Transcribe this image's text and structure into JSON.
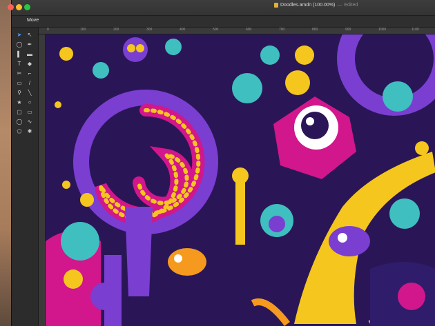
{
  "window": {
    "title": "Doodles.amdn (100.00%)",
    "separator": "—",
    "status": "Edited"
  },
  "toolbar": {
    "active_tool": "Move"
  },
  "ruler": {
    "ticks": [
      "0",
      "100",
      "200",
      "300",
      "400",
      "500",
      "600",
      "700",
      "800",
      "900",
      "1000",
      "1100"
    ]
  },
  "tools": [
    {
      "name": "move-tool-icon"
    },
    {
      "name": "node-tool-icon"
    },
    {
      "name": "lasso-icon"
    },
    {
      "name": "pen-tool-icon"
    },
    {
      "name": "brush-icon"
    },
    {
      "name": "gradient-icon"
    },
    {
      "name": "text-tool-icon"
    },
    {
      "name": "fill-icon"
    },
    {
      "name": "scissors-icon"
    },
    {
      "name": "eyedropper-icon"
    },
    {
      "name": "crop-icon"
    },
    {
      "name": "brush-icon"
    },
    {
      "name": "zoom-icon"
    },
    {
      "name": "line-icon"
    },
    {
      "name": "star-icon"
    },
    {
      "name": "circle-icon"
    },
    {
      "name": "rectangle-icon"
    },
    {
      "name": "rounded-rectangle-icon"
    },
    {
      "name": "ellipse-icon"
    },
    {
      "name": "curve-icon"
    },
    {
      "name": "shape-icon"
    },
    {
      "name": "gear-icon"
    }
  ],
  "colors": {
    "canvas_bg": "#2a1657",
    "purple": "#7a3ed1",
    "magenta": "#d2168c",
    "yellow": "#f5c61e",
    "teal": "#3fbfbf",
    "orange": "#f59a1e"
  }
}
